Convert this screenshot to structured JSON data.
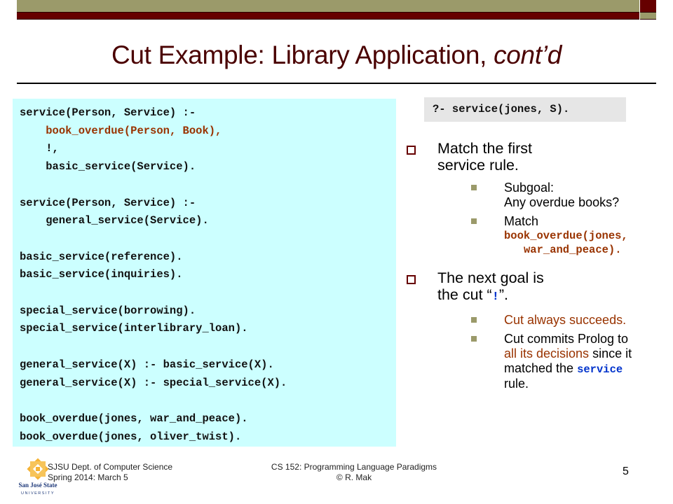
{
  "title": {
    "main": "Cut Example: Library Application, ",
    "italic": "cont’d"
  },
  "code_lines": [
    {
      "text": "service(Person, Service) :-",
      "highlight": false
    },
    {
      "text": "    book_overdue(Person, Book),",
      "highlight": true
    },
    {
      "text": "    !,",
      "highlight": false
    },
    {
      "text": "    basic_service(Service).",
      "highlight": false
    },
    {
      "text": "",
      "highlight": false
    },
    {
      "text": "service(Person, Service) :-",
      "highlight": false
    },
    {
      "text": "    general_service(Service).",
      "highlight": false
    },
    {
      "text": "",
      "highlight": false
    },
    {
      "text": "basic_service(reference).",
      "highlight": false
    },
    {
      "text": "basic_service(inquiries).",
      "highlight": false
    },
    {
      "text": "",
      "highlight": false
    },
    {
      "text": "special_service(borrowing).",
      "highlight": false
    },
    {
      "text": "special_service(interlibrary_loan).",
      "highlight": false
    },
    {
      "text": "",
      "highlight": false
    },
    {
      "text": "general_service(X) :- basic_service(X).",
      "highlight": false
    },
    {
      "text": "general_service(X) :- special_service(X).",
      "highlight": false
    },
    {
      "text": "",
      "highlight": false
    },
    {
      "text": "book_overdue(jones, war_and_peace).",
      "highlight": false
    },
    {
      "text": "book_overdue(jones, oliver_twist).",
      "highlight": false
    }
  ],
  "query": "?- service(jones, S).",
  "bullets": {
    "first": {
      "line1": "Match the first",
      "line2": "service rule.",
      "sub1_line1": "Subgoal:",
      "sub1_line2": "Any overdue books?",
      "sub2_label": "Match",
      "sub2_code1": "book_overdue(jones,",
      "sub2_code2": "war_and_peace)."
    },
    "second": {
      "line1": "The next goal is",
      "line2_pre": "the cut “",
      "line2_code": "!",
      "line2_post": "”.",
      "sub1": "Cut always succeeds.",
      "sub2_pre": "Cut commits Prolog to",
      "sub2_red": "all its decisions",
      "sub2_mid": " since it",
      "sub2_line3_pre": "matched the ",
      "sub2_code": "service",
      "sub2_post": "rule."
    }
  },
  "footer": {
    "dept": "SJSU Dept. of Computer Science",
    "date": "Spring 2014:  March 5",
    "course": "CS 152: Programming Language Paradigms",
    "author": "© R. Mak",
    "page": "5",
    "logo_text1": "San José State",
    "logo_text2": "UNIVERSITY"
  },
  "colors": {
    "maroon": "#660000",
    "olive": "#9b9a6a",
    "code_bg": "#ccffff",
    "highlight": "#993300",
    "code_blue": "#0033cc",
    "logo_gold": "#f5b335",
    "logo_blue": "#1f3a7a"
  }
}
